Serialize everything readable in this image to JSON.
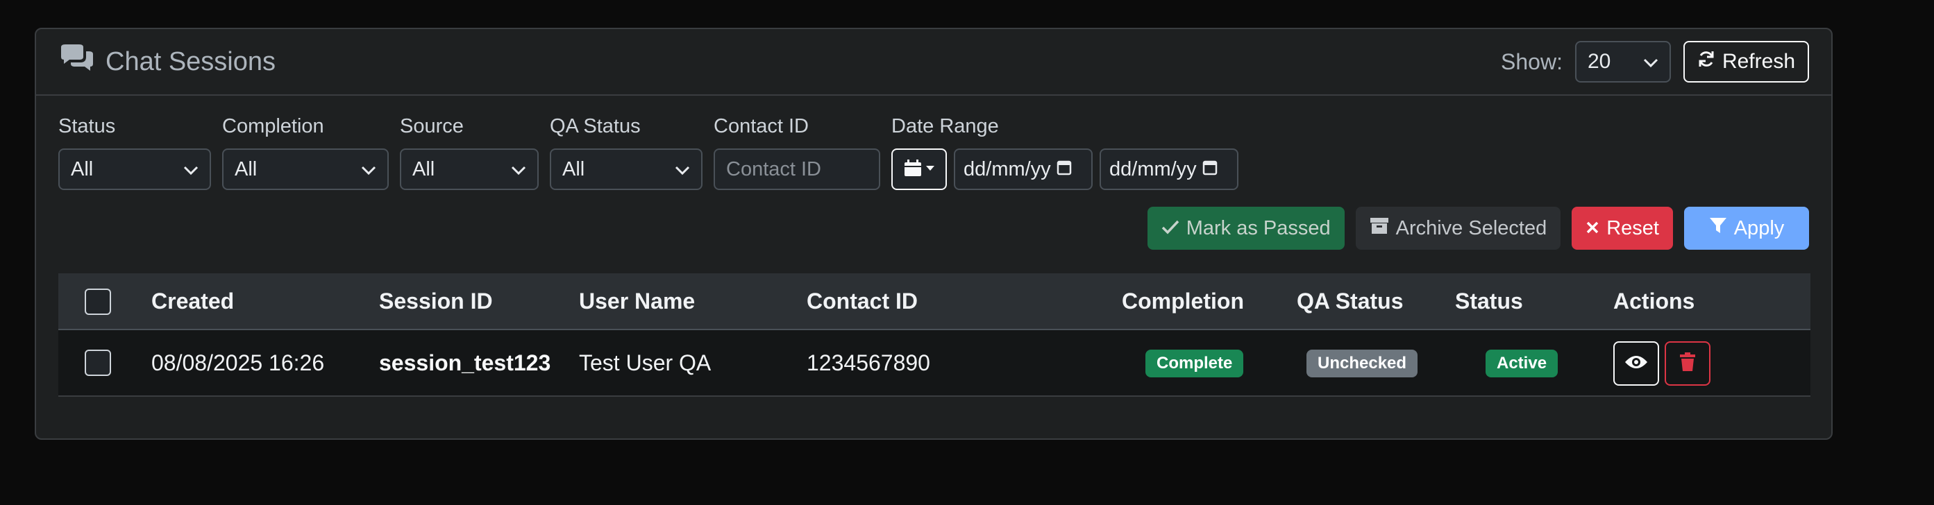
{
  "header": {
    "title": "Chat Sessions",
    "show_label": "Show:",
    "page_size": "20",
    "refresh_label": "Refresh"
  },
  "filters": {
    "status": {
      "label": "Status",
      "value": "All"
    },
    "completion": {
      "label": "Completion",
      "value": "All"
    },
    "source": {
      "label": "Source",
      "value": "All"
    },
    "qa_status": {
      "label": "QA Status",
      "value": "All"
    },
    "contact_id": {
      "label": "Contact ID",
      "placeholder": "Contact ID"
    },
    "date_range": {
      "label": "Date Range",
      "from_placeholder": "dd/mm/yy",
      "to_placeholder": "dd/mm/yy"
    }
  },
  "actions": {
    "mark_passed": "Mark as Passed",
    "archive": "Archive Selected",
    "reset": "Reset",
    "apply": "Apply"
  },
  "table": {
    "columns": {
      "created": "Created",
      "session_id": "Session ID",
      "user_name": "User Name",
      "contact_id": "Contact ID",
      "completion": "Completion",
      "qa_status": "QA Status",
      "status": "Status",
      "actions": "Actions"
    },
    "rows": [
      {
        "created": "08/08/2025 16:26",
        "session_id": "session_test123",
        "user_name": "Test User QA",
        "contact_id": "1234567890",
        "completion": "Complete",
        "qa_status": "Unchecked",
        "status": "Active"
      }
    ]
  },
  "colors": {
    "success": "#198754",
    "secondary": "#6c757d",
    "danger": "#dc3545",
    "primary": "#6ea8fe"
  },
  "icons": [
    "comments-icon",
    "chevron-down-icon",
    "refresh-icon",
    "calendar-icon",
    "check-icon",
    "archive-icon",
    "x-icon",
    "filter-icon",
    "eye-icon",
    "trash-icon"
  ]
}
